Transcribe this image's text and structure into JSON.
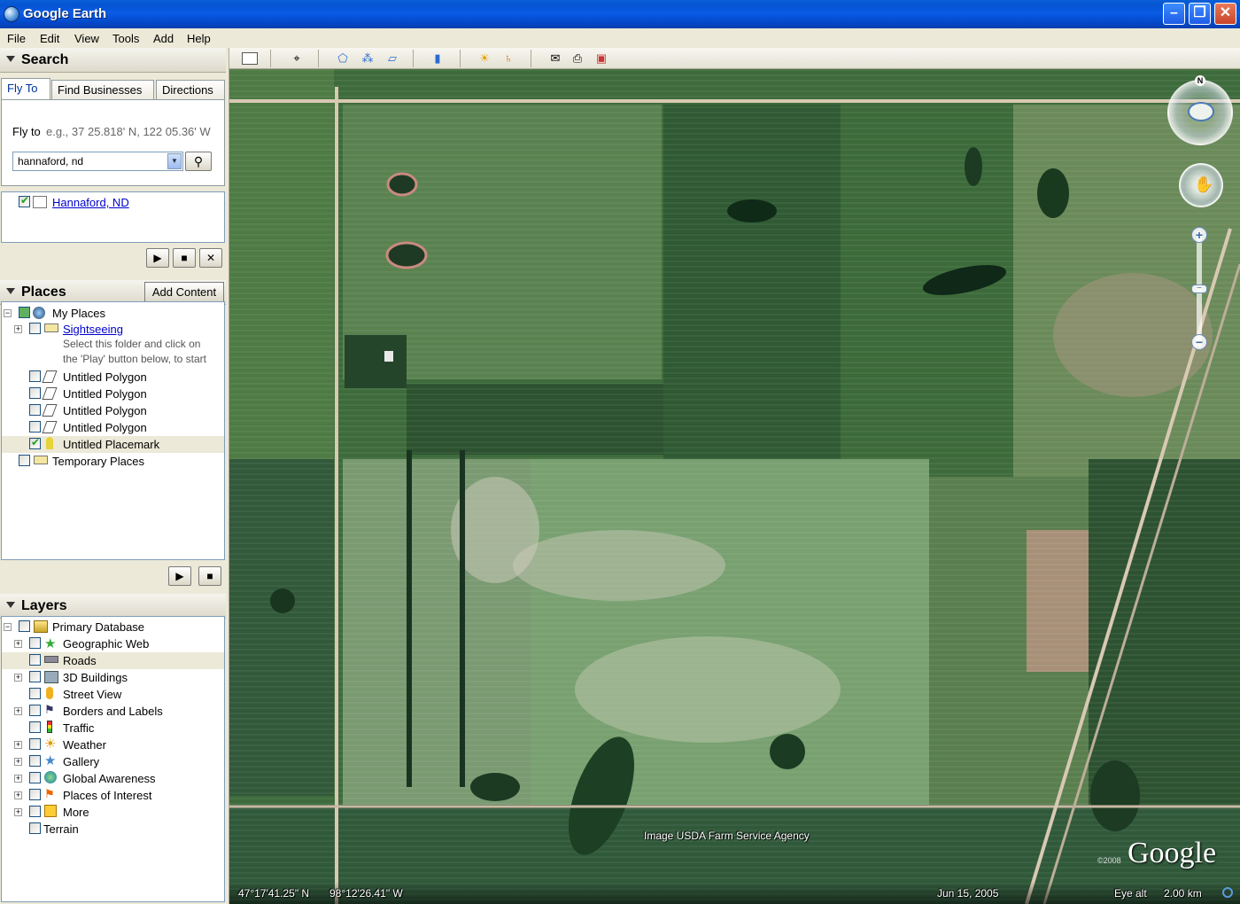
{
  "window": {
    "title": "Google Earth",
    "min": "–",
    "max": "❐",
    "close": "✕"
  },
  "menu": [
    "File",
    "Edit",
    "View",
    "Tools",
    "Add",
    "Help"
  ],
  "search": {
    "title": "Search",
    "tabs": [
      "Fly To",
      "Find Businesses",
      "Directions"
    ],
    "fly_to_label": "Fly to",
    "fly_to_hint": "e.g., 37 25.818' N, 122 05.36' W",
    "input_value": "hannaford, nd",
    "result": "Hannaford, ND"
  },
  "places": {
    "title": "Places",
    "add_content": "Add Content",
    "my_places": "My Places",
    "sightseeing": "Sightseeing",
    "sightseeing_hint_1": "Select this folder and click on",
    "sightseeing_hint_2": "the 'Play' button below, to start",
    "items": [
      "Untitled Polygon",
      "Untitled Polygon",
      "Untitled Polygon",
      "Untitled Polygon",
      "Untitled Placemark"
    ],
    "temporary": "Temporary Places"
  },
  "layers": {
    "title": "Layers",
    "root": "Primary Database",
    "items": [
      "Geographic Web",
      "Roads",
      "3D Buildings",
      "Street View",
      "Borders and Labels",
      "Traffic",
      "Weather",
      "Gallery",
      "Global Awareness",
      "Places of Interest",
      "More"
    ],
    "terrain": "Terrain"
  },
  "map": {
    "attribution": "Image USDA Farm Service Agency",
    "logo": "Google",
    "copyright": "©2008",
    "compass_n": "N",
    "status": {
      "lat": "47°17'41.25\" N",
      "lon": "98°12'26.41\" W",
      "date": "Jun 15, 2005",
      "eye_alt_label": "Eye alt",
      "eye_alt": "2.00 km"
    }
  }
}
